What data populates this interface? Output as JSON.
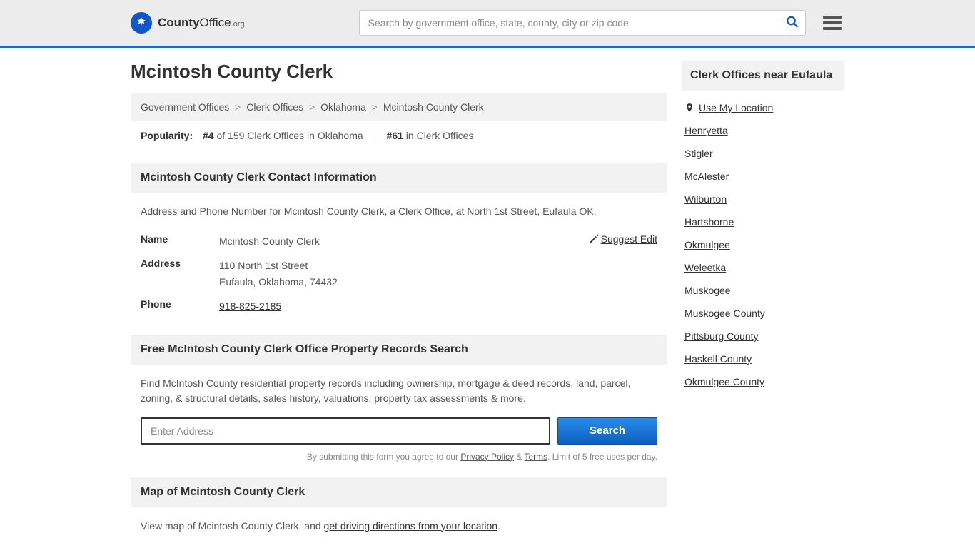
{
  "header": {
    "logo_text_bold": "County",
    "logo_text_rest": "Office",
    "logo_text_domain": ".org",
    "search_placeholder": "Search by government office, state, county, city or zip code"
  },
  "page": {
    "title": "Mcintosh County Clerk"
  },
  "breadcrumb": {
    "items": [
      "Government Offices",
      "Clerk Offices",
      "Oklahoma",
      "Mcintosh County Clerk"
    ],
    "sep": ">"
  },
  "popularity": {
    "label": "Popularity:",
    "rank1": "#4",
    "rank1_text": " of 159 Clerk Offices in Oklahoma",
    "rank2": "#61",
    "rank2_text": " in Clerk Offices"
  },
  "contact": {
    "section_title": "Mcintosh County Clerk Contact Information",
    "desc": "Address and Phone Number for Mcintosh County Clerk, a Clerk Office, at North 1st Street, Eufaula OK.",
    "name_label": "Name",
    "name_value": "Mcintosh County Clerk",
    "suggest_edit": "Suggest Edit",
    "address_label": "Address",
    "address_line1": "110 North 1st Street",
    "address_line2": "Eufaula, Oklahoma, 74432",
    "phone_label": "Phone",
    "phone_value": "918-825-2185"
  },
  "property": {
    "section_title": "Free McIntosh County Clerk Office Property Records Search",
    "desc": "Find McIntosh County residential property records including ownership, mortgage & deed records, land, parcel, zoning, & structural details, sales history, valuations, property tax assessments & more.",
    "input_placeholder": "Enter Address",
    "submit_label": "Search",
    "consent_pre": "By submitting this form you agree to our ",
    "consent_privacy": "Privacy Policy",
    "consent_amp": " & ",
    "consent_terms": "Terms",
    "consent_post": ". Limit of 5 free uses per day."
  },
  "map": {
    "section_title": "Map of Mcintosh County Clerk",
    "desc_pre": "View map of Mcintosh County Clerk, and ",
    "desc_link": "get driving directions from your location",
    "desc_post": "."
  },
  "sidebar": {
    "title": "Clerk Offices near Eufaula",
    "use_location": "Use My Location",
    "items": [
      "Henryetta",
      "Stigler",
      "McAlester",
      "Wilburton",
      "Hartshorne",
      "Okmulgee",
      "Weleetka",
      "Muskogee",
      "Muskogee County",
      "Pittsburg County",
      "Haskell County",
      "Okmulgee County"
    ]
  }
}
